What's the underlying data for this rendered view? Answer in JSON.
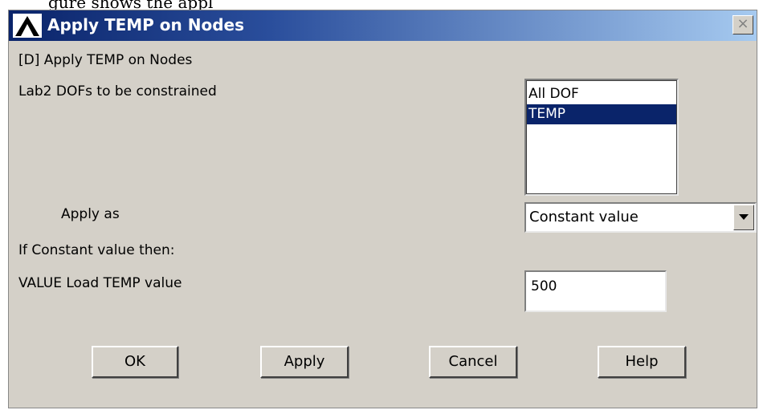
{
  "background_caption": "gure shows the appl",
  "dialog": {
    "title": "Apply TEMP on Nodes",
    "close_symbol": "×",
    "colors": {
      "titlebar_start": "#0a246a",
      "titlebar_end": "#a6caf0",
      "dialog_bg": "#d4d0c8",
      "selection": "#0a246a"
    }
  },
  "form": {
    "heading": "[D]  Apply TEMP on Nodes",
    "lab2_label": "Lab2    DOFs to be constrained",
    "dof_options": [
      {
        "label": "All DOF",
        "selected": false
      },
      {
        "label": "TEMP",
        "selected": true
      }
    ],
    "apply_as_label": "Apply as",
    "apply_as_value": "Constant value",
    "constant_note": "If Constant value then:",
    "value_label": "VALUE  Load TEMP value",
    "value_input": "500"
  },
  "buttons": {
    "ok": "OK",
    "apply": "Apply",
    "cancel": "Cancel",
    "help": "Help"
  },
  "icons": {
    "logo": "ansys-logo-icon",
    "dropdown": "chevron-down-icon",
    "close": "close-icon"
  }
}
